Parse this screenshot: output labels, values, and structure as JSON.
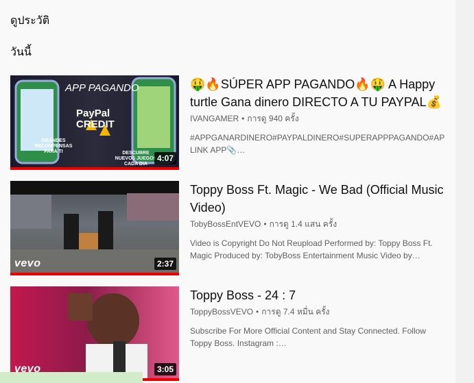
{
  "page": {
    "title": "ดูประวัติ",
    "section": "วันนี้"
  },
  "items": [
    {
      "title": "🤑🔥SÚPER APP PAGANDO🔥🤑 A Happy turtle Gana dinero DIRECTO A TU PAYPAL💰",
      "channel": "IVANGAMER",
      "views": "การดู 940 ครั้ง",
      "description": "#APPGANARDINERO#PAYPALDINERO#SUPERAPPPAGANDO#API LINK APP📎…",
      "duration": "4:07",
      "thumb_overlay": "APP PAGANDO",
      "thumb_brand": "PayPal CREDIT",
      "thumb_left_caption": "GRANDES RECOMPENSAS PARA TI",
      "thumb_right_caption": "DESCUBRE NUEVOS JUEGOS CADA DIA",
      "progress": 1.0
    },
    {
      "title": "Toppy Boss Ft. Magic - We Bad (Official Music Video)",
      "channel": "TobyBossEntVEVO",
      "views": "การดู 1.4 แสน ครั้ง",
      "description": "Video is Copyright Do Not Reupload Performed by: Toppy Boss Ft. Magic Produced by: TobyBoss Entertainment Music Video by…",
      "duration": "2:37",
      "watermark": "vevo",
      "progress": 1.0
    },
    {
      "title": "Toppy Boss - 24 : 7",
      "channel": "ToppyBossVEVO",
      "views": "การดู 7.4 หมื่น ครั้ง",
      "description": "Subscribe For More Official Content and Stay Connected. Follow Toppy Boss. Instagram :…",
      "duration": "3:05",
      "watermark": "vevo",
      "progress": 1.0
    }
  ],
  "separator": "•",
  "colors": {
    "progress": "#ee0000",
    "background": "#f9f9f9"
  }
}
